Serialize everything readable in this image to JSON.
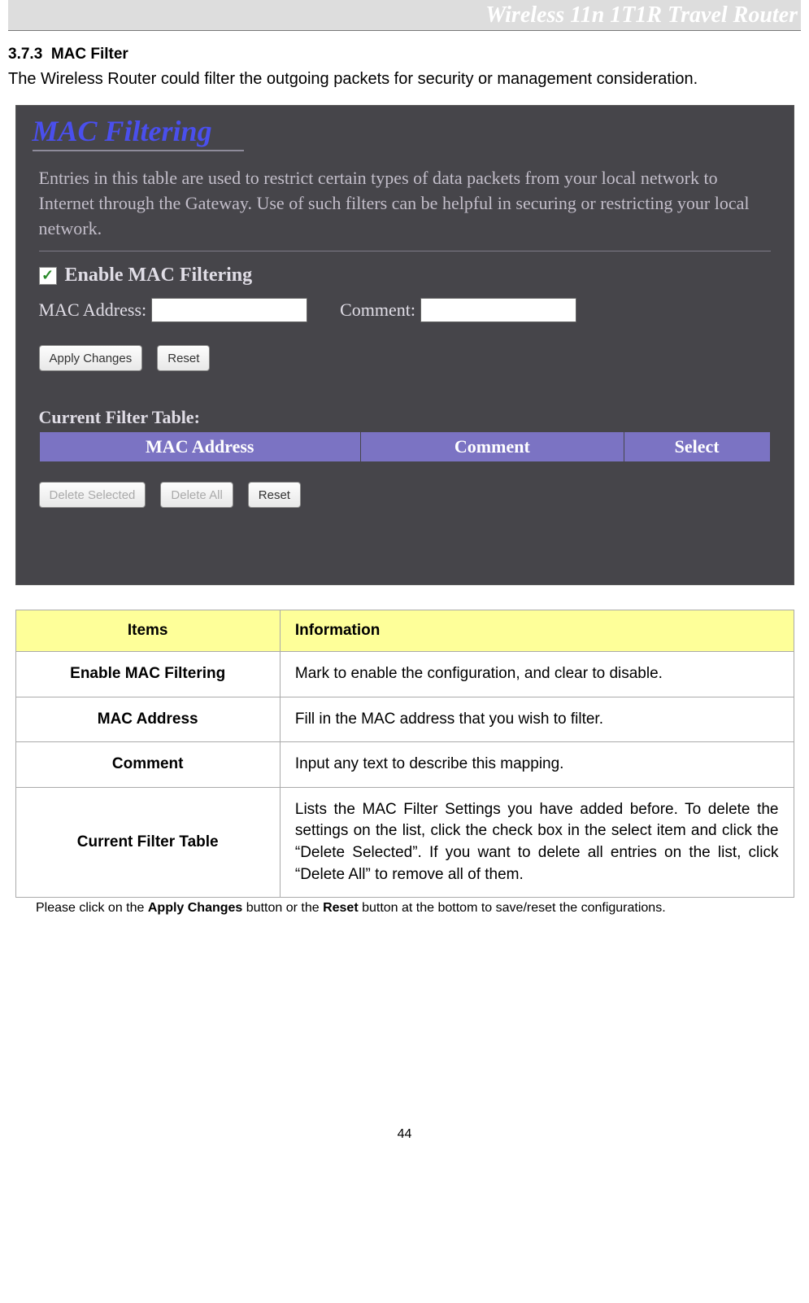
{
  "header": {
    "title": "Wireless 11n 1T1R Travel Router"
  },
  "section": {
    "number": "3.7.3",
    "title": "MAC Filter"
  },
  "intro": "The Wireless Router could filter the outgoing packets for security or management consideration.",
  "screenshot": {
    "title": "MAC Filtering",
    "description": "Entries in this table are used to restrict certain types of data packets from your local network to Internet through the Gateway. Use of such filters can be helpful in securing or restricting your local network.",
    "enable_checkbox_checked": "✓",
    "enable_label": "Enable MAC Filtering",
    "mac_label": "MAC Address:",
    "comment_label": "Comment:",
    "btn_apply": "Apply Changes",
    "btn_reset": "Reset",
    "subtitle": "Current Filter Table:",
    "th_mac": "MAC Address",
    "th_comment": "Comment",
    "th_select": "Select",
    "btn_delete_selected": "Delete Selected",
    "btn_delete_all": "Delete All",
    "btn_reset2": "Reset"
  },
  "info_table": {
    "header_items": "Items",
    "header_info": "Information",
    "rows": [
      {
        "item": "Enable MAC Filtering",
        "info": "Mark to enable the configuration, and clear to disable."
      },
      {
        "item": "MAC Address",
        "info": "Fill in the MAC address that you wish to filter."
      },
      {
        "item": "Comment",
        "info": "Input any text to describe this mapping."
      },
      {
        "item": "Current Filter Table",
        "info": "Lists the MAC Filter Settings you have added before. To delete the settings on the list, click the check box in the select item and click the “Delete Selected”. If you want to delete all entries on the list, click “Delete All” to remove all of them."
      }
    ]
  },
  "note": {
    "p1": "Please click on the ",
    "b1": "Apply Changes",
    "p2": " button or the ",
    "b2": "Reset",
    "p3": " button at the bottom to save/reset the configurations."
  },
  "page_number": "44"
}
